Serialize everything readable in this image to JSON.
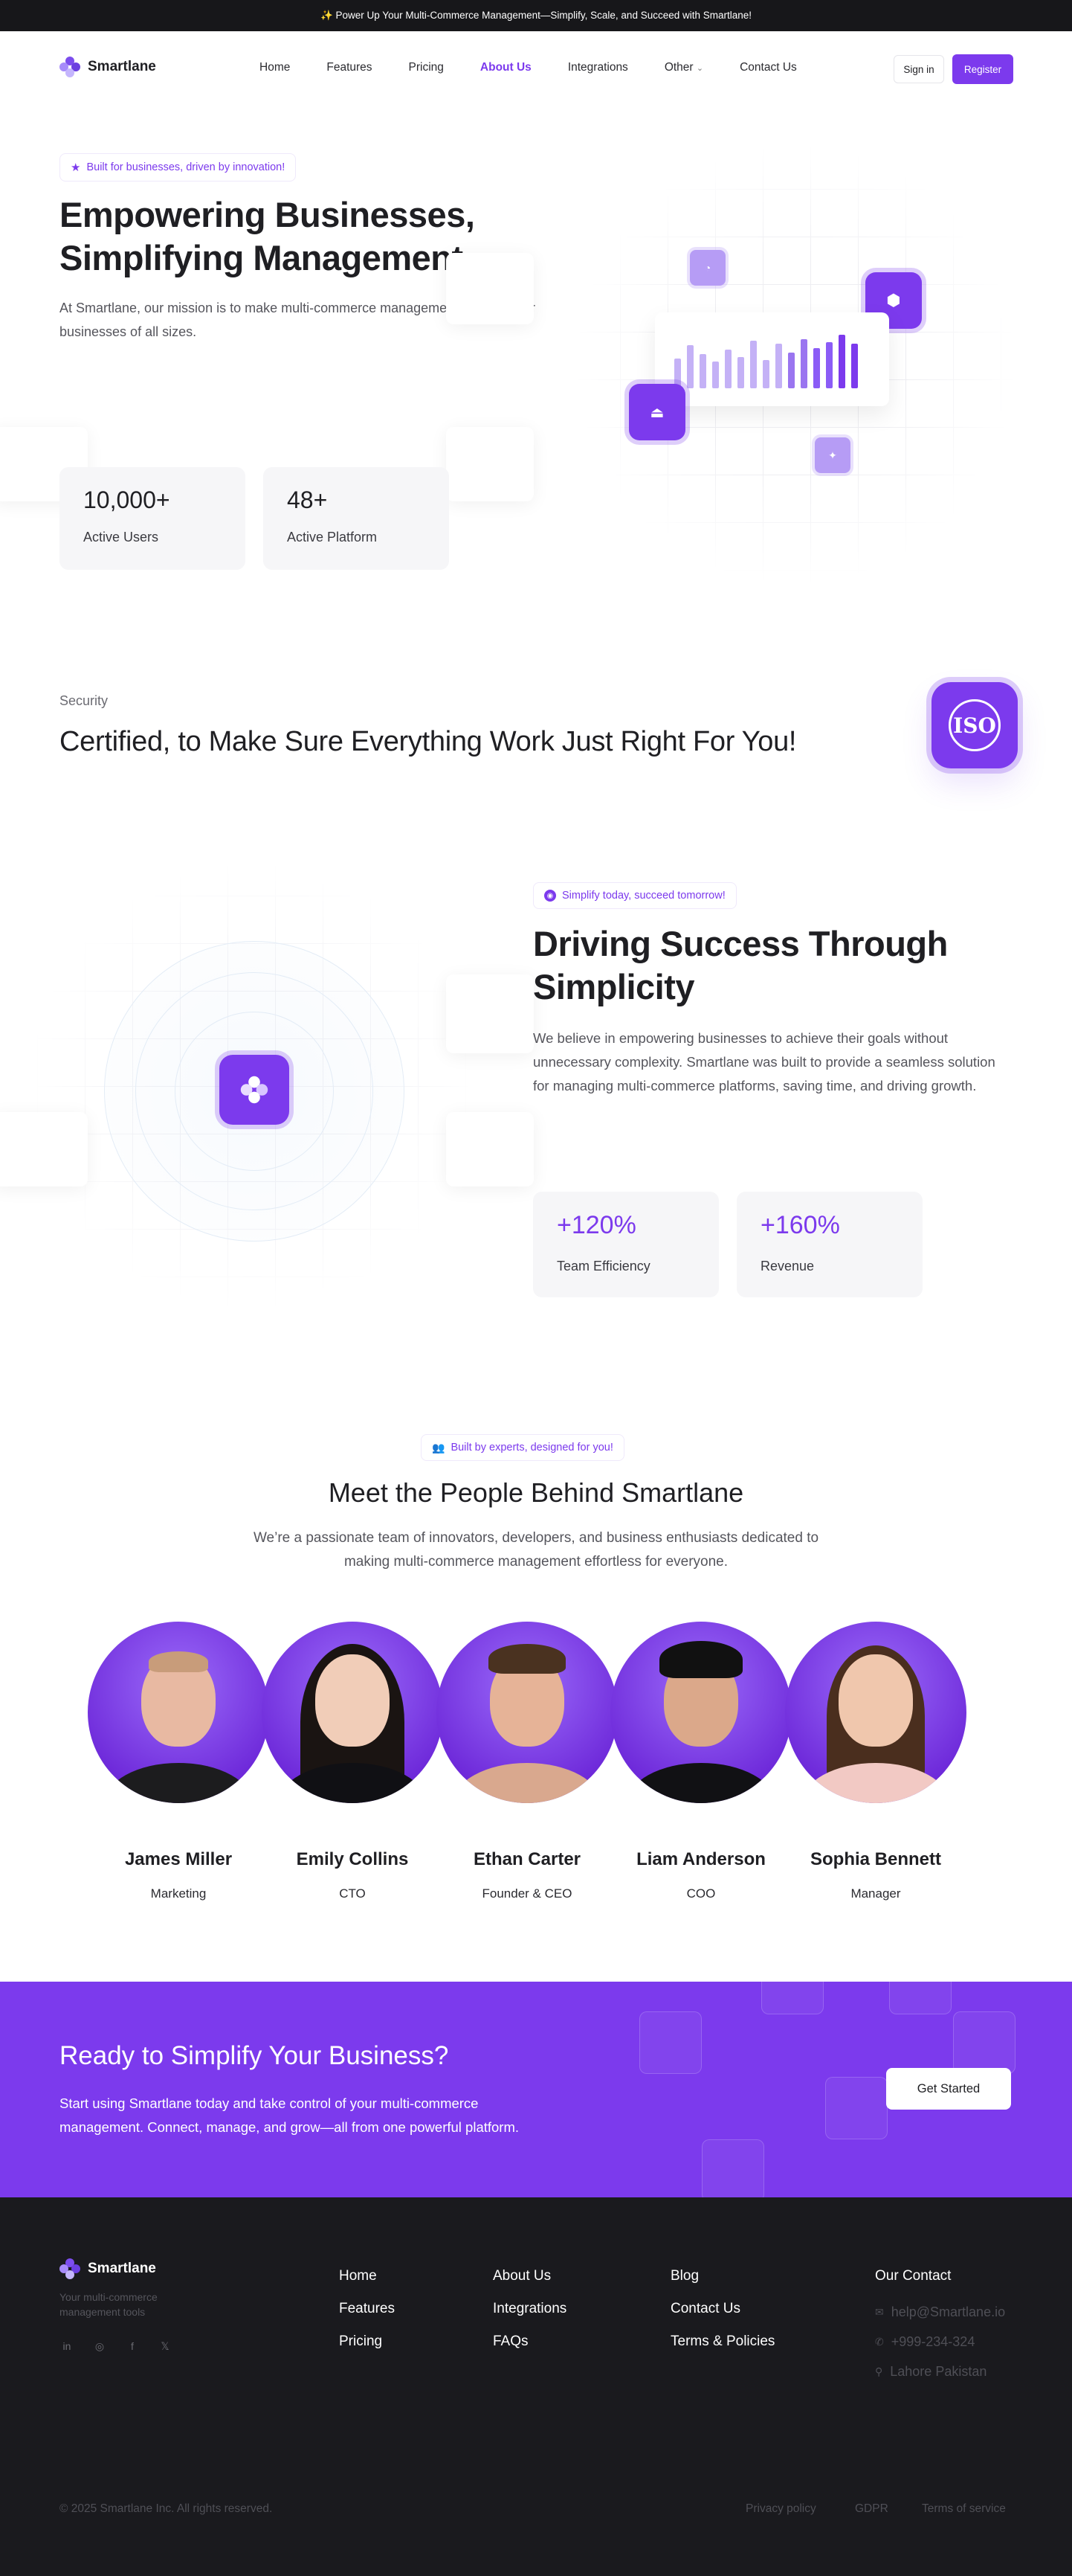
{
  "announcement": "✨ Power Up Your Multi-Commerce Management—Simplify, Scale, and Succeed with Smartlane!",
  "brand": {
    "name": "Smartlane",
    "accent": "#7c3aed"
  },
  "nav": {
    "items": [
      "Home",
      "Features",
      "Pricing",
      "About Us",
      "Integrations",
      "Other",
      "Contact Us"
    ],
    "active": "About Us",
    "signin": "Sign in",
    "register": "Register"
  },
  "hero": {
    "badge": "Built for businesses, driven by innovation!",
    "title_line1": "Empowering Businesses,",
    "title_line2": "Simplifying Management",
    "subtitle": "At Smartlane, our mission is to make multi-commerce management effortless for businesses of all sizes.",
    "stats": [
      {
        "value": "10,000+",
        "label": "Active Users"
      },
      {
        "value": "48+",
        "label": "Active Platform"
      }
    ]
  },
  "security": {
    "label": "Security",
    "title": "Certified, to Make Sure Everything Work Just Right For You!",
    "badge_text": "ISO"
  },
  "driving": {
    "badge": "Simplify today, succeed tomorrow!",
    "title_line1": "Driving Success Through",
    "title_line2": "Simplicity",
    "subtitle": "We believe in empowering businesses to achieve their goals without unnecessary complexity. Smartlane was built to provide a seamless solution for managing multi-commerce platforms, saving time, and driving growth.",
    "stats": [
      {
        "value": "+120%",
        "label": "Team Efficiency"
      },
      {
        "value": "+160%",
        "label": "Revenue"
      }
    ]
  },
  "team": {
    "badge": "Built by experts, designed for you!",
    "title": "Meet the People Behind Smartlane",
    "subtitle_line1": "We’re a passionate team of innovators, developers, and business enthusiasts dedicated to",
    "subtitle_line2": "making multi-commerce management effortless for everyone.",
    "members": [
      {
        "name": "James Miller",
        "role": "Marketing"
      },
      {
        "name": "Emily Collins",
        "role": "CTO"
      },
      {
        "name": "Ethan Carter",
        "role": "Founder & CEO"
      },
      {
        "name": "Liam Anderson",
        "role": "COO"
      },
      {
        "name": "Sophia Bennett",
        "role": "Manager"
      }
    ]
  },
  "cta": {
    "title": "Ready to Simplify Your Business?",
    "subtitle_line1": "Start using Smartlane today and take control of your multi-commerce",
    "subtitle_line2": "management. Connect, manage, and grow—all from one powerful platform.",
    "button": "Get Started"
  },
  "footer": {
    "tagline": "Your multi-commerce management tools",
    "col1": [
      "Home",
      "Features",
      "Pricing"
    ],
    "col2": [
      "About Us",
      "Integrations",
      "FAQs"
    ],
    "col3": [
      "Blog",
      "Contact Us",
      "Terms & Policies"
    ],
    "contact_heading": "Our Contact",
    "email": "help@Smartlane.io",
    "phone": "+999-234-324",
    "address": "Lahore Pakistan",
    "copyright": "© 2025 Smartlane Inc. All rights reserved.",
    "legal": [
      "Privacy policy",
      "GDPR",
      "Terms of service"
    ]
  }
}
